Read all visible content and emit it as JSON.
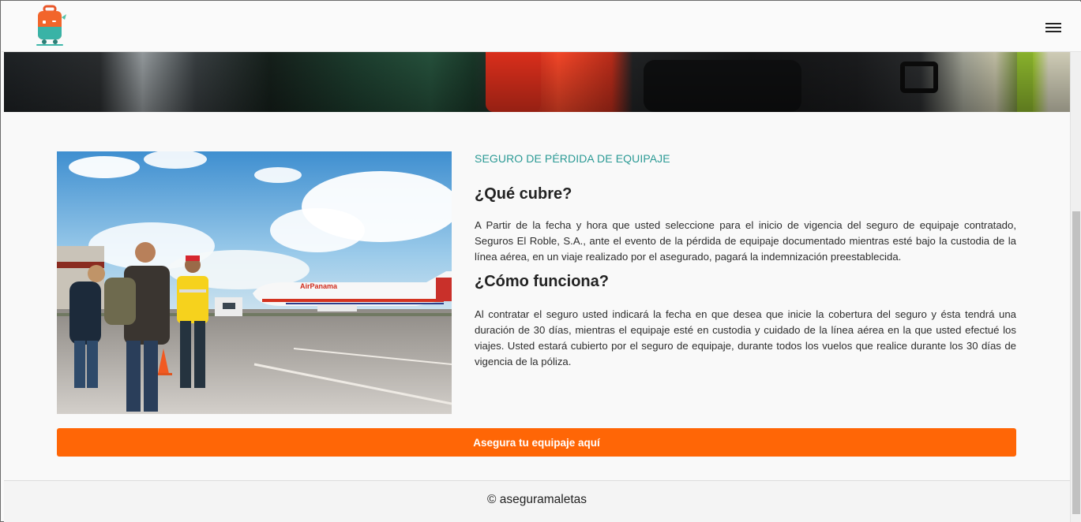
{
  "header": {
    "logo_icon": "suitcase-mascot-icon",
    "menu_icon": "hamburger-menu-icon"
  },
  "colors": {
    "accent_teal": "#2b9a95",
    "cta_orange": "#ff6606",
    "text_dark": "#222222"
  },
  "section": {
    "eyebrow": "SEGURO DE PÉRDIDA DE EQUIPAJE",
    "heading_1": "¿Qué cubre?",
    "paragraph_1": "A Partir de la fecha y hora que usted seleccione para el inicio de vigencia del seguro de equipaje contratado, Seguros El Roble, S.A., ante el evento de la pérdida de equipaje documentado mientras esté bajo la custodia de la línea aérea, en un viaje realizado por el asegurado, pagará la indemnización preestablecida.",
    "heading_2": "¿Cómo funciona?",
    "paragraph_2": "Al contratar el seguro usted indicará la fecha en que desea que inicie la cobertura del seguro y ésta tendrá una duración de 30 días, mientras el equipaje esté en custodia y cuidado de la línea aérea en la que usted efectué los viajes. Usted estará cubierto por el seguro de equipaje, durante todos los vuelos que realice durante los 30 días de vigencia de la póliza.",
    "cta_label": "Asegura tu equipaje aquí"
  },
  "photo": {
    "airline_text": "AirPanama"
  },
  "footer": {
    "copyright": "© aseguramaletas"
  }
}
